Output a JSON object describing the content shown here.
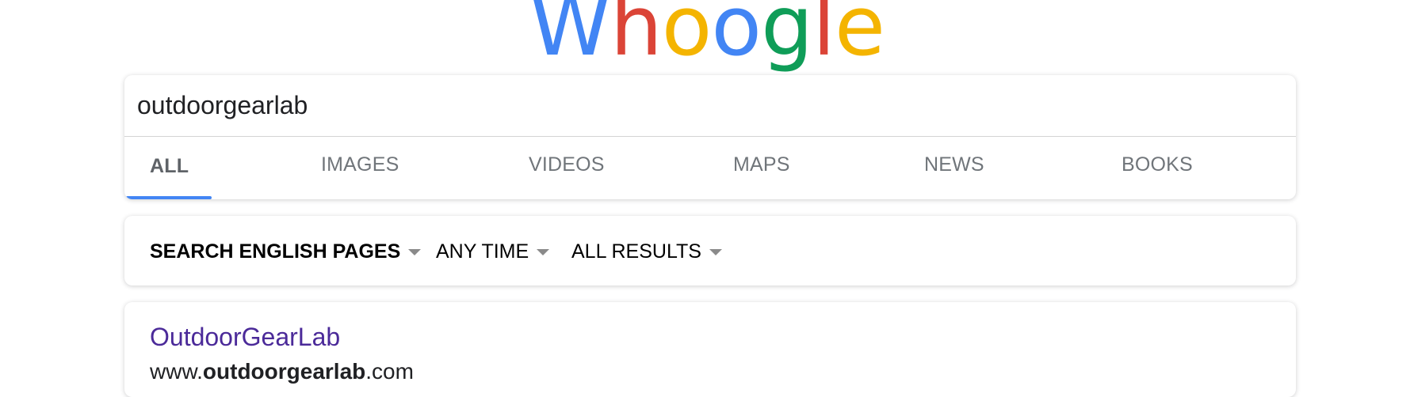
{
  "logo": {
    "letters": [
      "W",
      "h",
      "o",
      "o",
      "g",
      "l",
      "e"
    ],
    "colors": [
      "#4285f4",
      "#db4437",
      "#f4b400",
      "#4285f4",
      "#0f9d58",
      "#db4437",
      "#f4b400"
    ]
  },
  "search": {
    "value": "outdoorgearlab"
  },
  "tabs": [
    {
      "label": "ALL",
      "active": true
    },
    {
      "label": "IMAGES"
    },
    {
      "label": "VIDEOS"
    },
    {
      "label": "MAPS"
    },
    {
      "label": "NEWS"
    },
    {
      "label": "BOOKS"
    }
  ],
  "tab_accent_color": "#4285f4",
  "filters": [
    {
      "label": "SEARCH ENGLISH PAGES",
      "icon": "caret-down-icon"
    },
    {
      "label": "ANY TIME",
      "icon": "caret-down-icon"
    },
    {
      "label": "ALL RESULTS",
      "icon": "caret-down-icon"
    }
  ],
  "results": [
    {
      "title": "OutdoorGearLab",
      "url_prefix": "www.",
      "url_bold": "outdoorgearlab",
      "url_suffix": ".com",
      "title_color": "#4b2a99"
    }
  ]
}
